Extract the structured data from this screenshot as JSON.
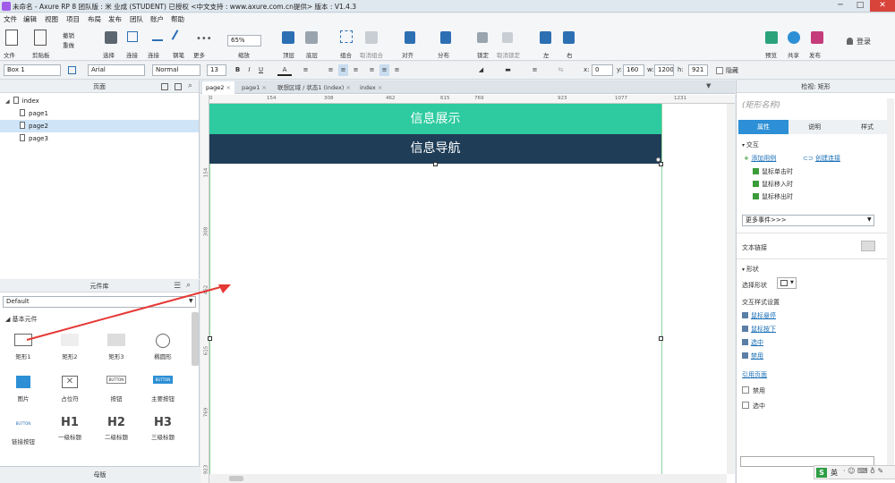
{
  "window": {
    "title": "未命名 - Axure RP 8 团队版 : 米 业成 (STUDENT) 已授权   <中文支持 : www.axure.com.cn提供> 版本 : V1.4.3",
    "min_glyph": "─",
    "max_glyph": "□",
    "close_glyph": "✕"
  },
  "menu": [
    "文件",
    "编辑",
    "视图",
    "项目",
    "布局",
    "发布",
    "团队",
    "账户",
    "帮助"
  ],
  "toolbar": {
    "file": "文件",
    "clipboard": "剪贴板",
    "undo": "撤销",
    "redo": "重做",
    "select": "选择",
    "connect": "连接",
    "pen": "钢笔",
    "more": "更多",
    "zoom_value": "65%",
    "zoom": "缩放",
    "top_layer": "顶层",
    "bottom_layer": "底层",
    "group": "组合",
    "ungroup": "取消组合",
    "align": "对齐",
    "distribute": "分布",
    "lock": "锁定",
    "unlock": "取消锁定",
    "left": "左",
    "right": "右",
    "preview": "预览",
    "share": "共享",
    "publish": "发布",
    "login": "登录"
  },
  "format": {
    "widget_name": "Box 1",
    "font": "Arial",
    "style": "Normal",
    "size": "13",
    "x_label": "x:",
    "x": "0",
    "y_label": "y:",
    "y": "160",
    "w_label": "w:",
    "w": "1200",
    "h_label": "h:",
    "h": "921",
    "hidden": "隐藏"
  },
  "pages_panel": {
    "title": "页面",
    "items": [
      {
        "label": "index"
      },
      {
        "label": "page1"
      },
      {
        "label": "page2"
      },
      {
        "label": "page3"
      }
    ]
  },
  "widget_panel": {
    "title": "元件库",
    "library": "Default",
    "section": "基本元件",
    "widgets": [
      "矩形1",
      "矩形2",
      "矩形3",
      "椭圆形",
      "图片",
      "占位符",
      "按钮",
      "主要按钮",
      "链接按钮",
      "一级标题",
      "二级标题",
      "三级标题"
    ],
    "button_text": "BUTTON",
    "h1": "H1",
    "h2": "H2",
    "h3": "H3"
  },
  "master_panel": {
    "title": "母版"
  },
  "tabs": [
    "page2",
    "page1",
    "联想区域 / 状态1 (index)",
    "index"
  ],
  "rulers": {
    "h": [
      "0",
      "154",
      "308",
      "462",
      "615",
      "769",
      "923",
      "1077",
      "1231"
    ],
    "v": [
      "154",
      "308",
      "462",
      "615",
      "769",
      "923"
    ]
  },
  "canvas": {
    "banner1": "信息展示",
    "banner2": "信息导航",
    "banner1_color": "#2ecba0",
    "banner2_color": "#1f3d57"
  },
  "inspector": {
    "title": "检视: 矩形",
    "name_placeholder": "(矩形名称)",
    "tabs": [
      "属性",
      "说明",
      "样式"
    ],
    "interaction": "交互",
    "add_case": "添加用例",
    "create_link": "创建连接",
    "events": [
      "鼠标单击时",
      "鼠标移入时",
      "鼠标移出时"
    ],
    "more_events": "更多事件>>>",
    "text_link": "文本链接",
    "shape": "形状",
    "select_shape": "选择形状",
    "interaction_styles": "交互样式设置",
    "mouse_hover": "鼠标悬停",
    "mouse_down": "鼠标按下",
    "selected": "选中",
    "disabled": "禁用",
    "reference_page": "引用页面",
    "chk_disabled": "禁用",
    "chk_selected": "选中"
  },
  "taskbar": {
    "ime": "英"
  }
}
